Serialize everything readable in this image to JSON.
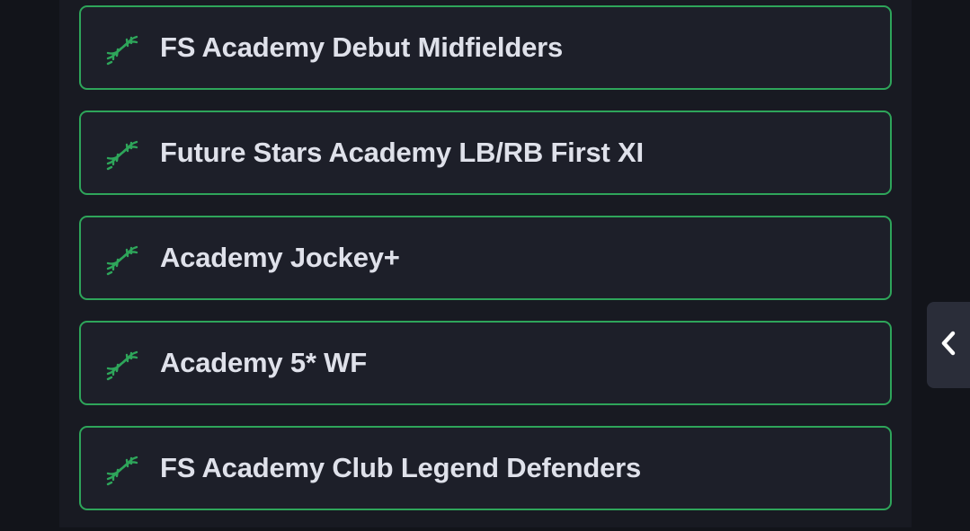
{
  "items": [
    {
      "label": "FS Academy Debut Midfielders",
      "icon": "dna-icon"
    },
    {
      "label": "Future Stars Academy LB/RB First XI",
      "icon": "dna-icon"
    },
    {
      "label": "Academy Jockey+",
      "icon": "dna-icon"
    },
    {
      "label": "Academy 5* WF",
      "icon": "dna-icon"
    },
    {
      "label": "FS Academy Club Legend Defenders",
      "icon": "dna-icon"
    }
  ],
  "side_toggle": {
    "icon": "chevron-left-icon"
  },
  "colors": {
    "accent": "#2ea55a",
    "background": "#12141a",
    "panel": "#181a22",
    "card": "#1d1f29",
    "text": "#dfe1ea"
  }
}
